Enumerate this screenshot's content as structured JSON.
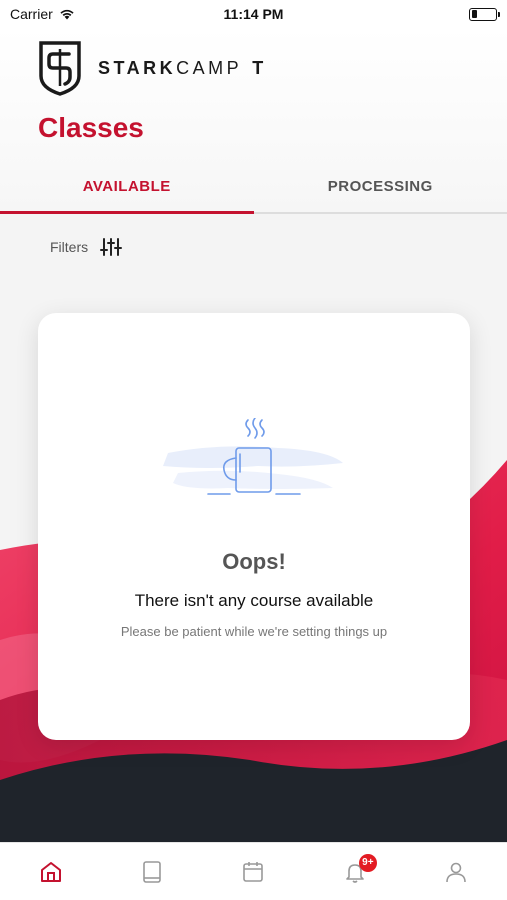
{
  "status_bar": {
    "carrier": "Carrier",
    "time": "11:14 PM",
    "battery_level": 0.25
  },
  "header": {
    "brand": {
      "part1": "STARK",
      "part2": "CAMP",
      "part3": "T"
    },
    "title": "Classes"
  },
  "tabs": [
    {
      "label": "AVAILABLE",
      "active": true
    },
    {
      "label": "PROCESSING",
      "active": false
    }
  ],
  "filters": {
    "label": "Filters",
    "icon": "sliders-icon"
  },
  "empty_state": {
    "icon": "coffee-mug-icon",
    "title": "Oops!",
    "message": "There isn't any course available",
    "subtitle": "Please be patient while we're setting things up"
  },
  "bottom_nav": {
    "items": [
      {
        "icon": "home-icon",
        "active": true
      },
      {
        "icon": "book-icon",
        "active": false
      },
      {
        "icon": "calendar-icon",
        "active": false
      },
      {
        "icon": "bell-icon",
        "active": false,
        "badge": "9+"
      },
      {
        "icon": "profile-icon",
        "active": false
      }
    ]
  },
  "colors": {
    "accent": "#c4122f",
    "wave_red": "#e8254a",
    "wave_dark": "#1f242b",
    "badge": "#e31b23"
  }
}
